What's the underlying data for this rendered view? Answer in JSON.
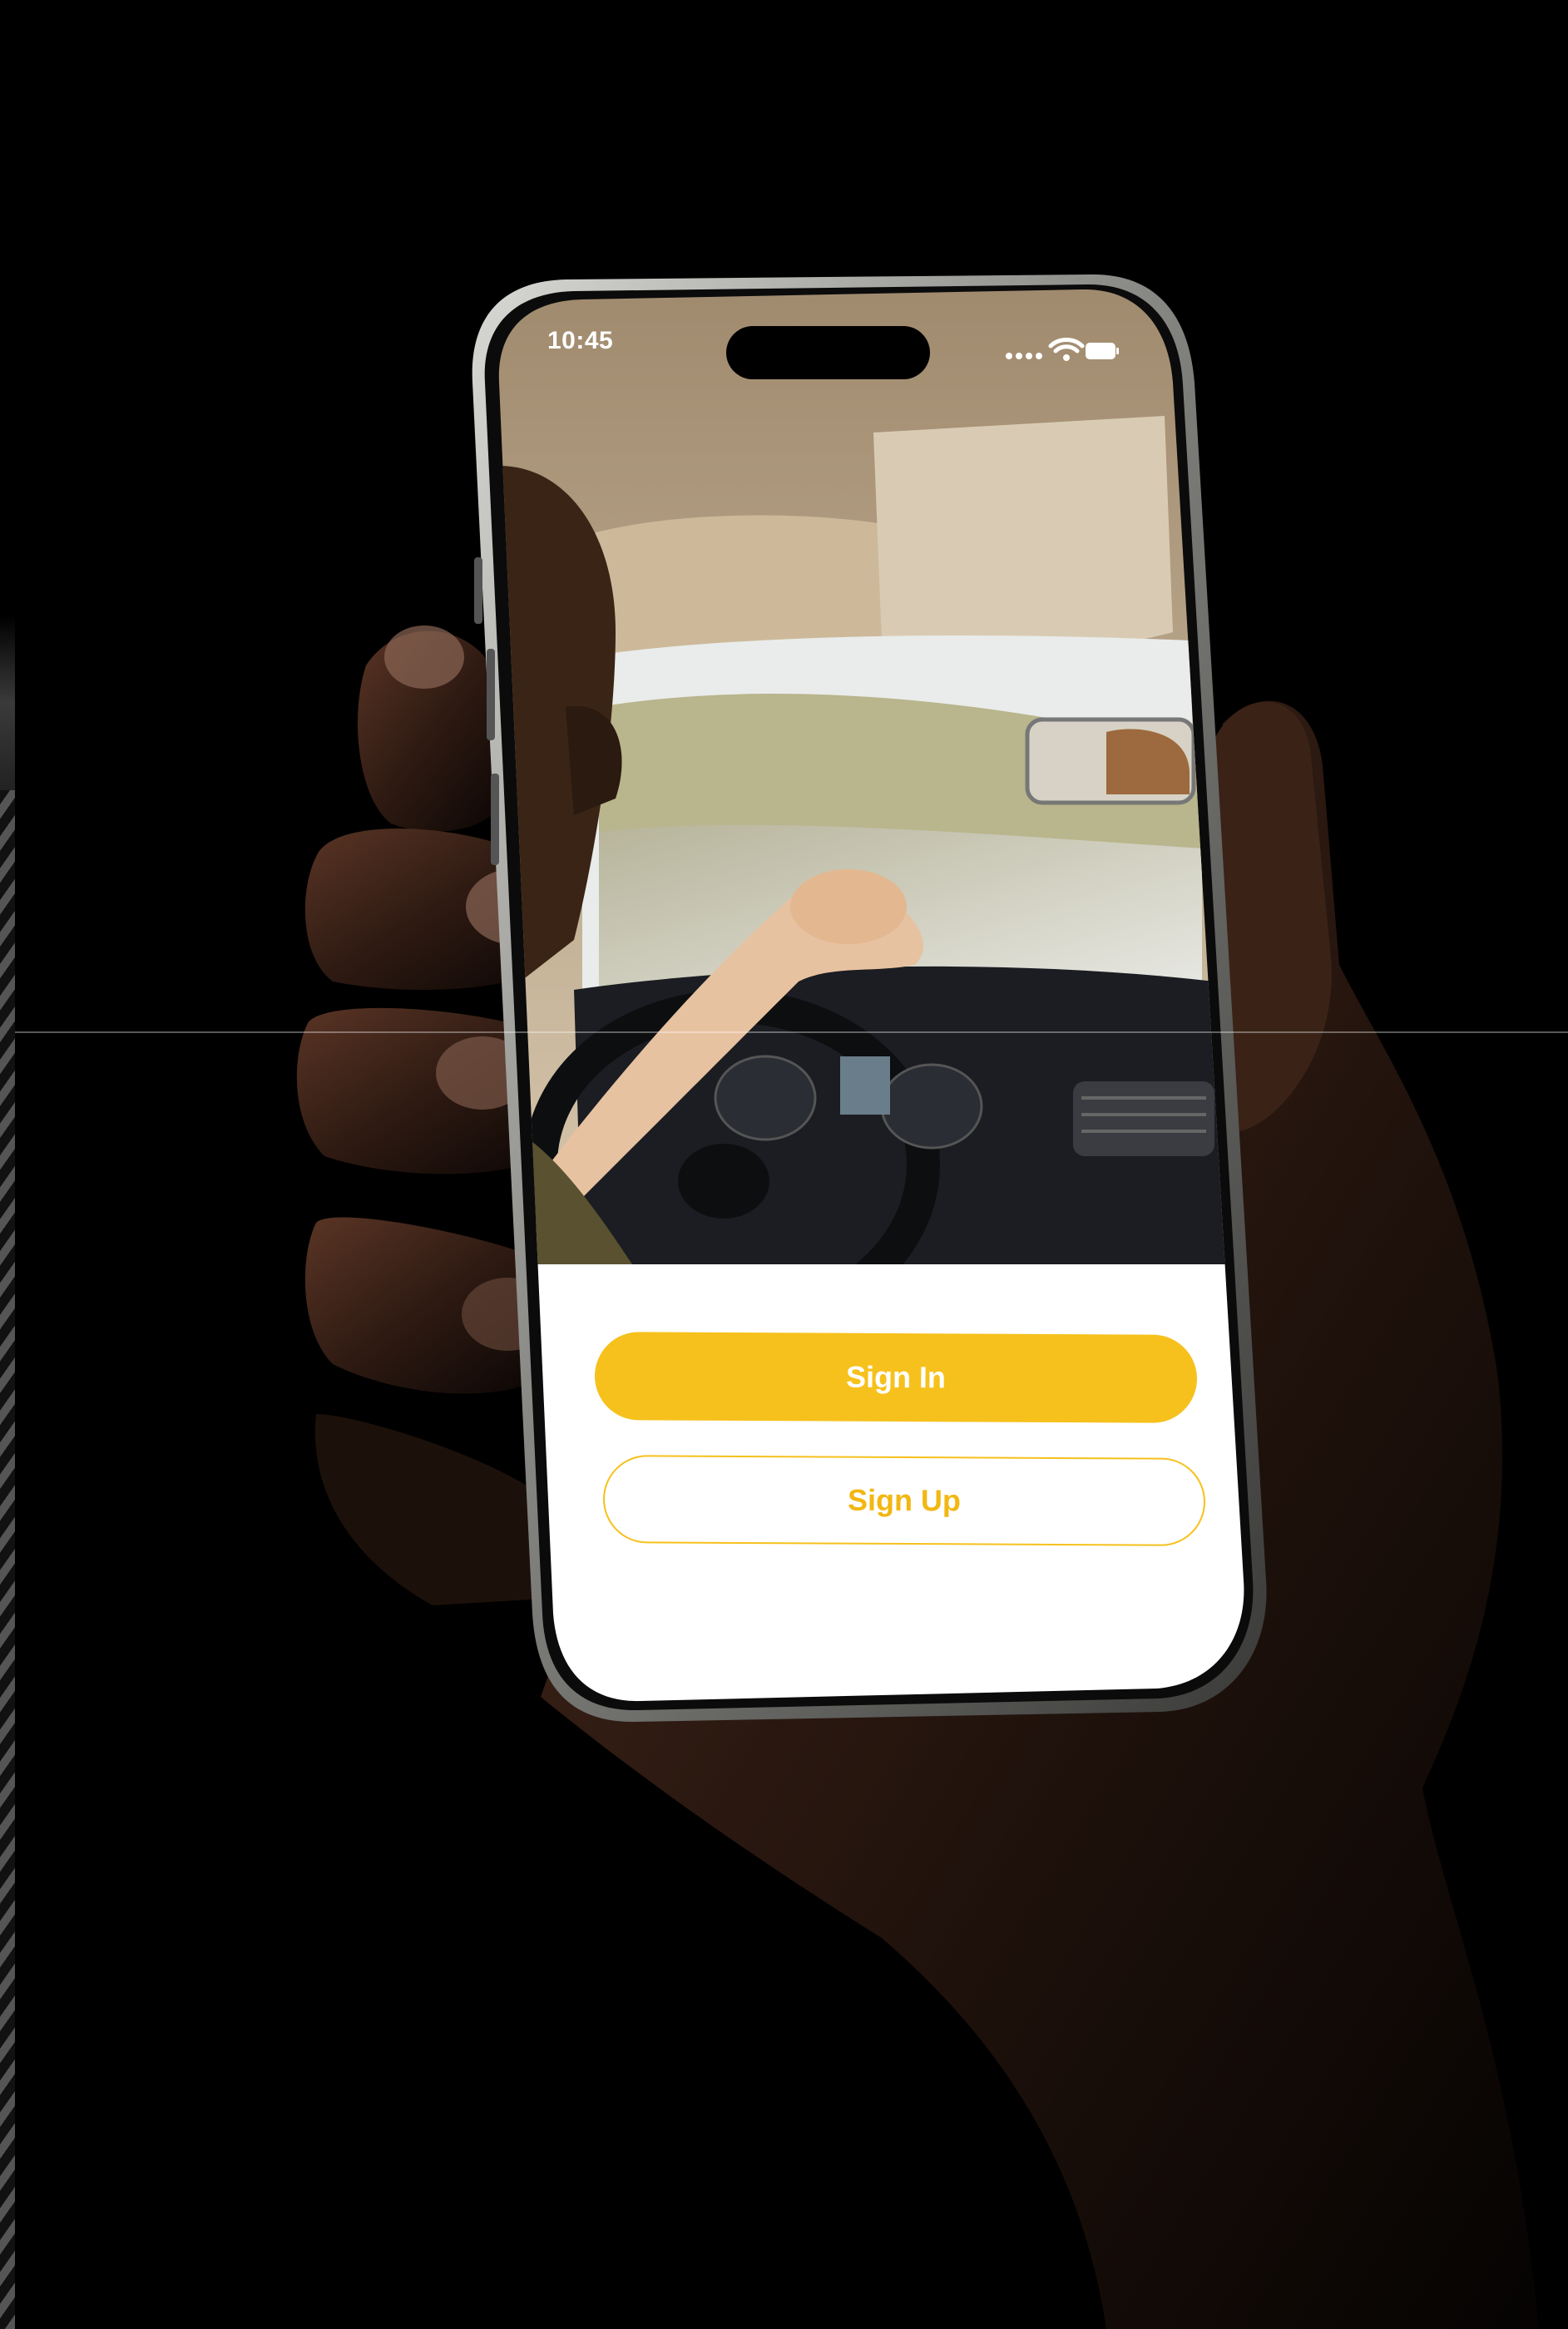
{
  "status_bar": {
    "time": "10:45",
    "signal_icon": "signal-dots-icon",
    "wifi_icon": "wifi-icon",
    "battery_icon": "battery-icon"
  },
  "hero": {
    "image": "driver-in-car-photo"
  },
  "actions": {
    "sign_in_label": "Sign In",
    "sign_up_label": "Sign Up"
  },
  "colors": {
    "accent": "#F6C11C",
    "background": "#000000",
    "sheet": "#FFFFFF"
  }
}
